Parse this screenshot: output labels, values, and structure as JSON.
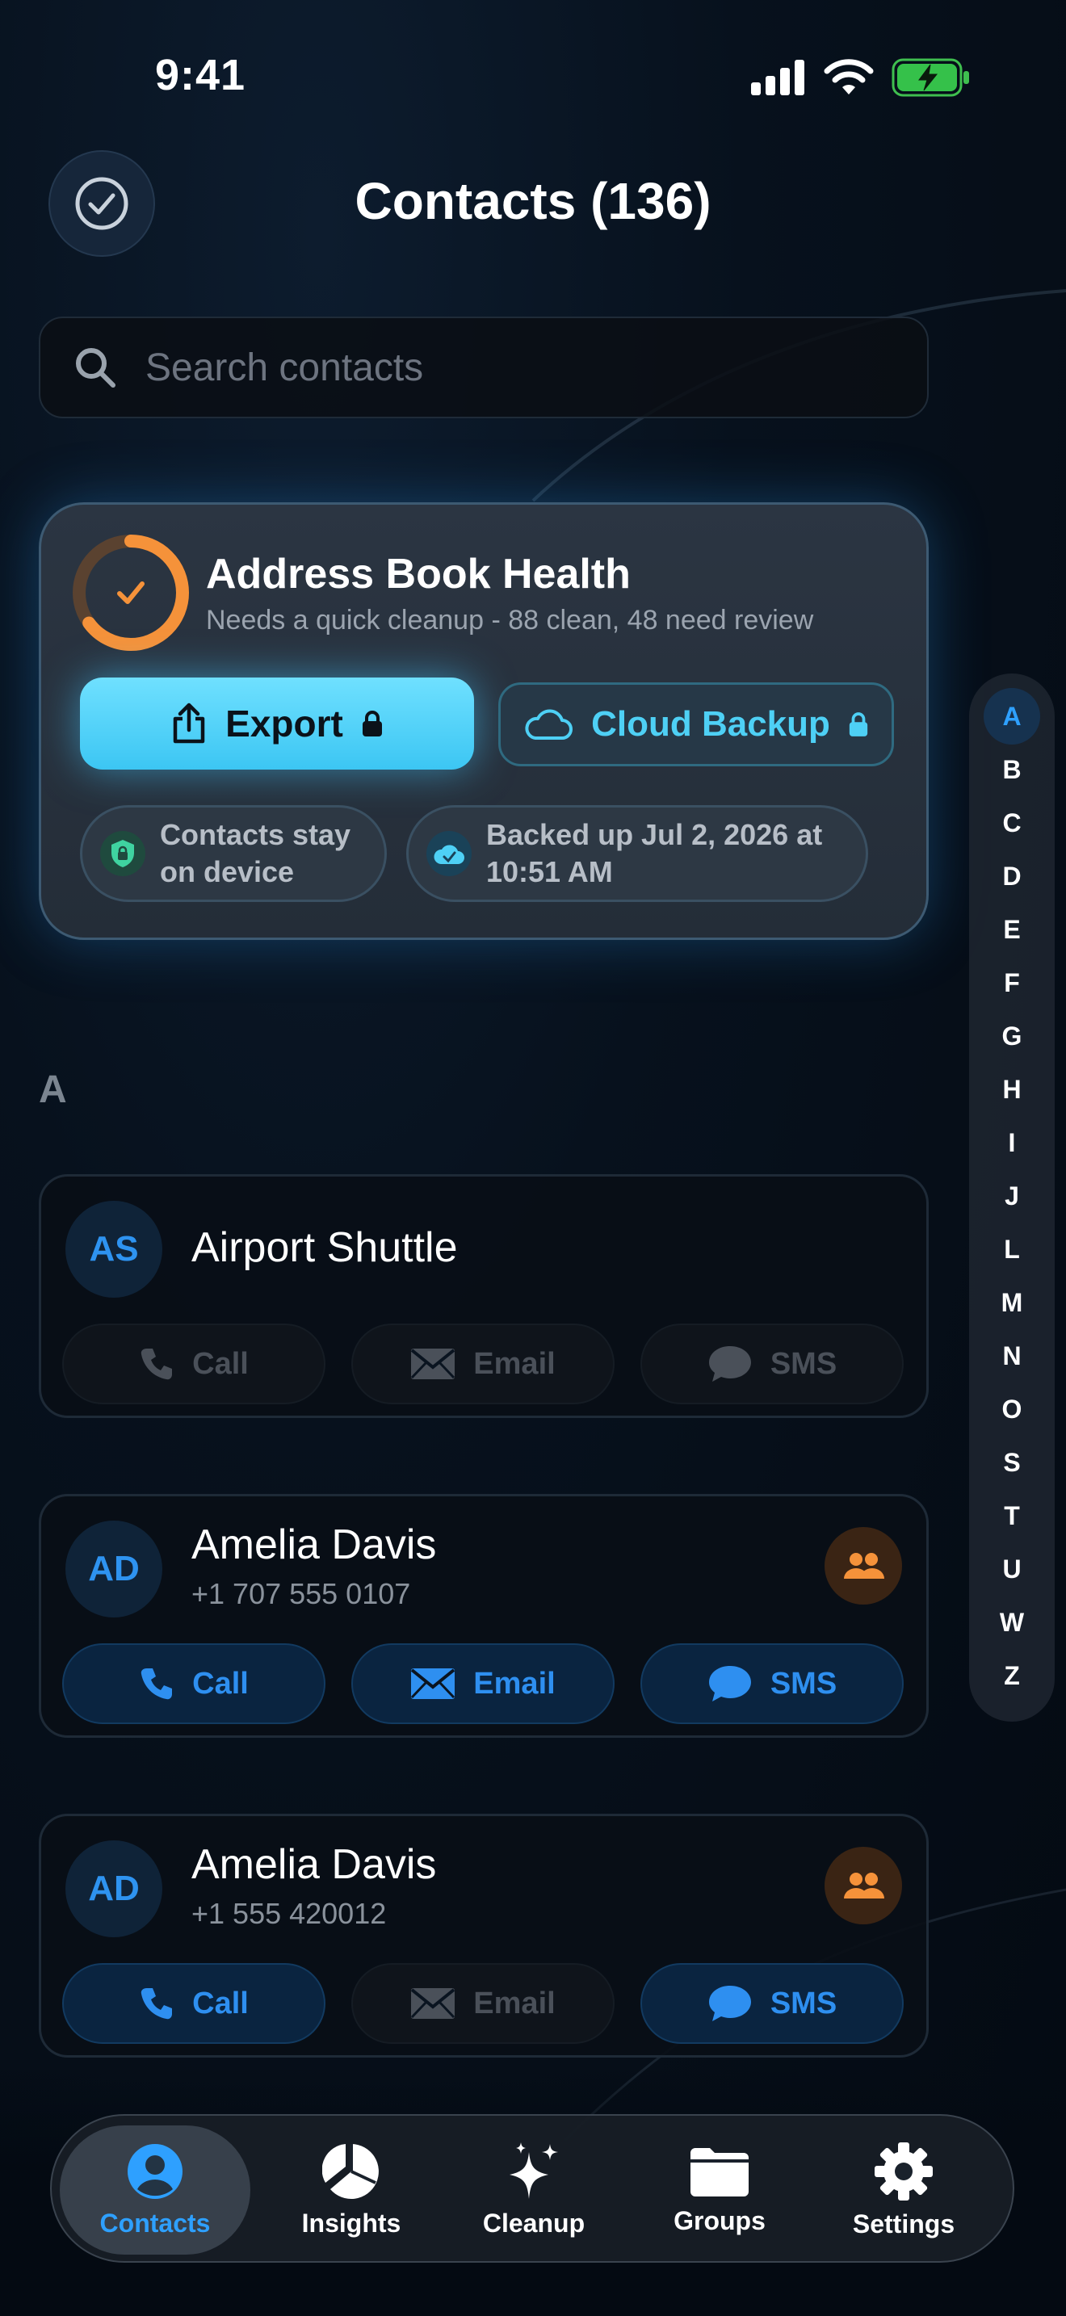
{
  "status_bar": {
    "time": "9:41"
  },
  "header": {
    "title": "Contacts (136)"
  },
  "search": {
    "placeholder": "Search contacts"
  },
  "health": {
    "title": "Address Book Health",
    "subtitle": "Needs a quick cleanup - 88 clean, 48 need review",
    "clean_fraction": 0.65,
    "export_label": "Export",
    "cloud_label": "Cloud Backup",
    "device_line1": "Contacts stay",
    "device_line2": "on device",
    "backup_line1": "Backed up Jul 2, 2026 at",
    "backup_line2": "10:51 AM"
  },
  "section_letter": "A",
  "contacts": [
    {
      "initials": "AS",
      "name": "Airport Shuttle",
      "phone": "",
      "call": "Call",
      "email": "Email",
      "sms": "SMS",
      "call_enabled": false,
      "email_enabled": false,
      "sms_enabled": false,
      "group": false
    },
    {
      "initials": "AD",
      "name": "Amelia Davis",
      "phone": "+1 707 555 0107",
      "call": "Call",
      "email": "Email",
      "sms": "SMS",
      "call_enabled": true,
      "email_enabled": true,
      "sms_enabled": true,
      "group": true
    },
    {
      "initials": "AD",
      "name": "Amelia Davis",
      "phone": "+1 555 420012",
      "call": "Call",
      "email": "Email",
      "sms": "SMS",
      "call_enabled": true,
      "email_enabled": false,
      "sms_enabled": true,
      "group": true
    }
  ],
  "index_letters": [
    "A",
    "B",
    "C",
    "D",
    "E",
    "F",
    "G",
    "H",
    "I",
    "J",
    "L",
    "M",
    "N",
    "O",
    "S",
    "T",
    "U",
    "W",
    "Z"
  ],
  "tabs": [
    {
      "label": "Contacts",
      "icon": "person-circle-icon"
    },
    {
      "label": "Insights",
      "icon": "pie-chart-icon"
    },
    {
      "label": "Cleanup",
      "icon": "sparkles-icon"
    },
    {
      "label": "Groups",
      "icon": "folder-icon"
    },
    {
      "label": "Settings",
      "icon": "gear-icon"
    }
  ],
  "colors": {
    "accent": "#2ea0ff",
    "export": "#4fd0f7",
    "ring": "#f5923a",
    "badge": "#f5923a"
  }
}
